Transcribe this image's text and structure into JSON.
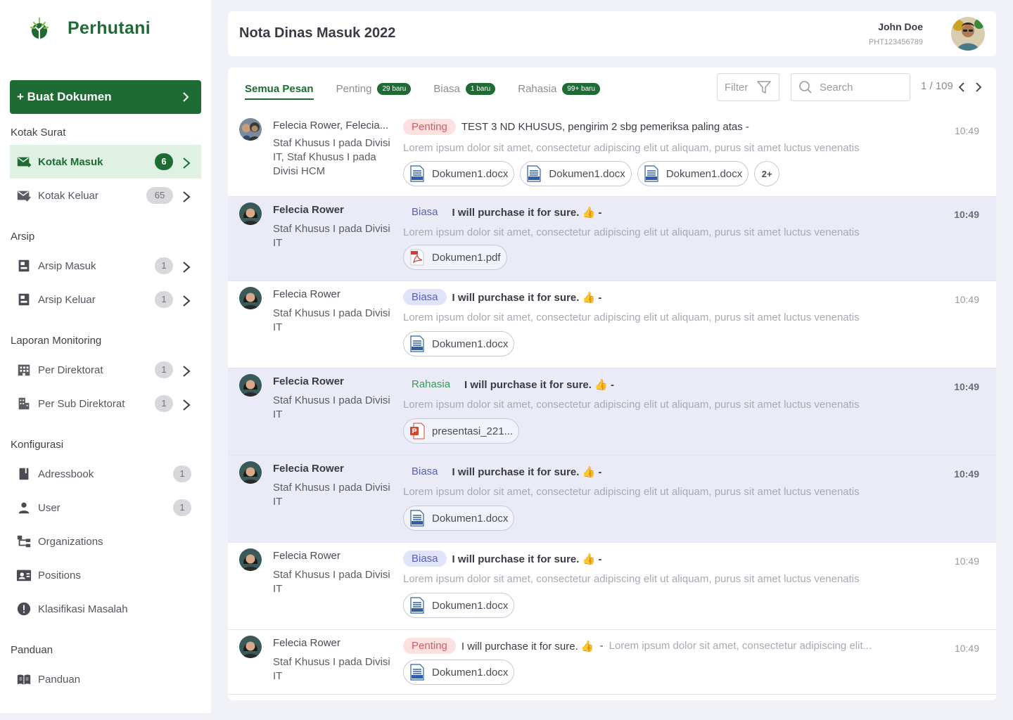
{
  "brand": {
    "name": "Perhutani",
    "color": "#1e6b34"
  },
  "sidebar": {
    "create_label": "+ Buat Dokumen",
    "sections": {
      "kotak_surat": "Kotak Surat",
      "arsip": "Arsip",
      "laporan": "Laporan Monitoring",
      "konfigurasi": "Konfigurasi",
      "panduan": "Panduan"
    },
    "items": {
      "kotak_masuk": {
        "label": "Kotak Masuk",
        "count": "6",
        "icon": "mail-in-icon"
      },
      "kotak_keluar": {
        "label": "Kotak Keluar",
        "count": "65",
        "icon": "mail-out-icon"
      },
      "arsip_masuk": {
        "label": "Arsip Masuk",
        "count": "1",
        "icon": "archive-in-icon"
      },
      "arsip_keluar": {
        "label": "Arsip Keluar",
        "count": "1",
        "icon": "archive-out-icon"
      },
      "per_direktorat": {
        "label": "Per Direktorat",
        "count": "1",
        "icon": "building-icon"
      },
      "per_sub_direktorat": {
        "label": "Per Sub Direktorat",
        "count": "1",
        "icon": "sub-building-icon"
      },
      "adressbook": {
        "label": "Adressbook",
        "count": "1",
        "icon": "book-icon"
      },
      "user": {
        "label": "User",
        "count": "1",
        "icon": "user-icon"
      },
      "organizations": {
        "label": "Organizations",
        "icon": "org-chart-icon"
      },
      "positions": {
        "label": "Positions",
        "icon": "id-card-icon"
      },
      "klasifikasi": {
        "label": "Klasifikasi Masalah",
        "icon": "alert-icon"
      },
      "panduan": {
        "label": "Panduan",
        "icon": "manual-icon"
      }
    }
  },
  "header": {
    "title": "Nota Dinas Masuk 2022",
    "user_name": "John Doe",
    "user_id": "PHT123456789"
  },
  "toolbar": {
    "tabs": [
      {
        "label": "Semua Pesan"
      },
      {
        "label": "Penting",
        "badge": "29 baru"
      },
      {
        "label": "Biasa",
        "badge": "1 baru"
      },
      {
        "label": "Rahasia",
        "badge": "99+ baru"
      }
    ],
    "filter_label": "Filter",
    "search_placeholder": "Search",
    "pager": "1 / 109"
  },
  "messages": [
    {
      "sender": "Felecia Rower, Felecia...",
      "role": "Staf Khusus I pada Divisi IT, Staf Khusus I pada Divisi HCM",
      "tag": "Penting",
      "subject": "TEST 3 ND KHUSUS, pengirim 2 sbg pemeriksa paling atas -",
      "preview": "Lorem ipsum dolor sit amet, consectetur adipiscing elit ut aliquam, purus sit amet luctus venenatis",
      "time": "10:49",
      "attachments": [
        "Dokumen1.docx",
        "Dokumen1.docx",
        "Dokumen1.docx"
      ],
      "more": "2+"
    },
    {
      "sender": "Felecia Rower",
      "role": "Staf Khusus I pada Divisi IT",
      "tag": "Biasa",
      "subject": "I will purchase it for sure. 👍 -",
      "preview": "Lorem ipsum dolor sit amet, consectetur adipiscing elit ut aliquam, purus sit amet luctus venenatis",
      "time": "10:49",
      "attachments": [
        "Dokumen1.pdf"
      ]
    },
    {
      "sender": "Felecia Rower",
      "role": "Staf Khusus I pada Divisi IT",
      "tag": "Biasa",
      "subject": "I will purchase it for sure. 👍 -",
      "preview": "Lorem ipsum dolor sit amet, consectetur adipiscing elit ut aliquam, purus sit amet luctus venenatis",
      "time": "10:49",
      "attachments": [
        "Dokumen1.docx"
      ]
    },
    {
      "sender": "Felecia Rower",
      "role": "Staf Khusus I pada Divisi IT",
      "tag": "Rahasia",
      "subject": "I will purchase it for sure. 👍 -",
      "preview": "Lorem ipsum dolor sit amet, consectetur adipiscing elit ut aliquam, purus sit amet luctus venenatis",
      "time": "10:49",
      "attachments": [
        "presentasi_221..."
      ]
    },
    {
      "sender": "Felecia Rower",
      "role": "Staf Khusus I pada Divisi IT",
      "tag": "Biasa",
      "subject": "I will purchase it for sure. 👍 -",
      "preview": "Lorem ipsum dolor sit amet, consectetur adipiscing elit ut aliquam, purus sit amet luctus venenatis",
      "time": "10:49",
      "attachments": [
        "Dokumen1.docx"
      ]
    },
    {
      "sender": "Felecia Rower",
      "role": "Staf Khusus I pada Divisi IT",
      "tag": "Biasa",
      "subject": "I will purchase it for sure. 👍 -",
      "preview": "Lorem ipsum dolor sit amet, consectetur adipiscing elit ut aliquam, purus sit amet luctus venenatis",
      "time": "10:49",
      "attachments": [
        "Dokumen1.docx"
      ]
    },
    {
      "sender": "Felecia Rower",
      "role": "Staf Khusus I pada Divisi IT",
      "tag": "Penting",
      "subject": "I will purchase it for sure. 👍",
      "dash": "-",
      "preview": "Lorem ipsum dolor sit amet, consectetur adipiscing elit...",
      "time": "10:49",
      "attachments": [
        "Dokumen1.docx"
      ]
    }
  ]
}
